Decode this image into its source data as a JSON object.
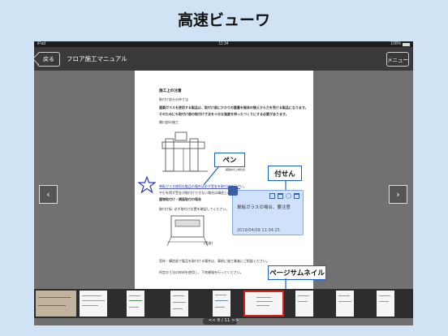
{
  "promo_title": "高速ビューワ",
  "statusbar": {
    "carrier": "iPad",
    "time": "11:34",
    "battery": "100%"
  },
  "navbar": {
    "back_label": "戻る",
    "title": "フロア施工マニュアル",
    "menu_label": "メニュー"
  },
  "document": {
    "lines": [
      "施工上の注意",
      "取付け部分の仲寸法",
      "建築ガラスを使用する製品は、取付け部にかかりの重量を極体の揃えから力を受ける製品になります。",
      "そのためにも取付け部の取付け寸法を十分な強度を持ったつくりにする必要があります。",
      "開口部の施工",
      "補強材の上端位置",
      "単板ガラス使用の製品の場合は必ず受金を取付けて下さい。",
      "やむを得ず受金が取付けできない場合は構造上のご相談ください。",
      "建物取付け・横面取付の場合",
      "取付け板: 必ず取付け位置を確認してください。",
      "(別途)",
      "窓枠・構造部で製品を取付ける場合は、事前に施工業者にご相談ください。",
      "所定の寸法の枠材を使用し、下地補強を行ってください。"
    ]
  },
  "annotations": {
    "pen_label": "ペン",
    "sticky_label": "付せん",
    "thumbnail_label": "ページサムネイル"
  },
  "sticky_note": {
    "text": "単板ガラスの場合、要注意",
    "date": "2019/04/09 11:34:25"
  },
  "thumbnails": {
    "count": 11,
    "selected_index": 6
  },
  "page_indicator": "<< 8 / 11 >>",
  "colors": {
    "accent": "#1a5fcf",
    "selected_thumb": "#e0201e",
    "sticky_bg": "#cfe1fb"
  }
}
